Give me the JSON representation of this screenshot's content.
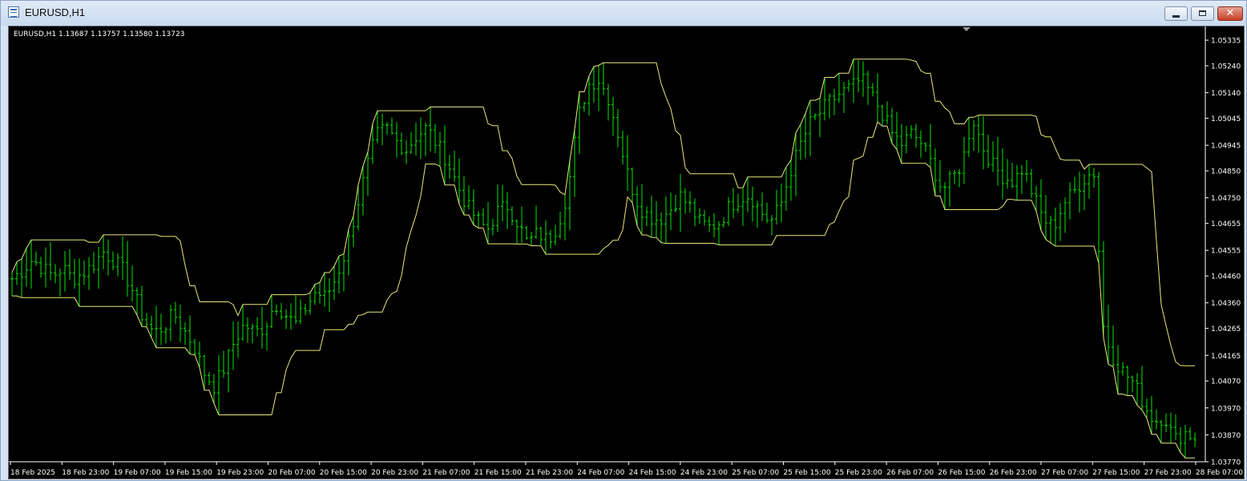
{
  "window": {
    "title": "EURUSD,H1",
    "icon": "chart-window-icon",
    "buttons": [
      "minimize-icon",
      "maximize-icon",
      "close-icon"
    ],
    "close_glyph": "✕"
  },
  "chart_info": "EURUSD,H1  1.13687 1.13757 1.13580 1.13723",
  "colors": {
    "background": "#000000",
    "candles": "#00e600",
    "channel": "#e8e87a",
    "axis": "#ffffff",
    "text": "#ffffff"
  },
  "chart_data": {
    "type": "ohlc",
    "symbol": "EURUSD",
    "timeframe": "H1",
    "title": "EURUSD,H1",
    "info": "1.13687 1.13757 1.13580 1.13723",
    "ylim": [
      1.0377,
      1.0538
    ],
    "y_ticks": [
      "1.05335",
      "1.05240",
      "1.05140",
      "1.05045",
      "1.04945",
      "1.04850",
      "1.04750",
      "1.04655",
      "1.04555",
      "1.04460",
      "1.04360",
      "1.04265",
      "1.04165",
      "1.04070",
      "1.03970",
      "1.03870",
      "1.03770"
    ],
    "x_ticks": [
      "18 Feb 2025",
      "18 Feb 23:00",
      "19 Feb 07:00",
      "19 Feb 15:00",
      "19 Feb 23:00",
      "20 Feb 07:00",
      "20 Feb 15:00",
      "20 Feb 23:00",
      "21 Feb 07:00",
      "21 Feb 15:00",
      "21 Feb 23:00",
      "24 Feb 07:00",
      "24 Feb 15:00",
      "24 Feb 23:00",
      "25 Feb 07:00",
      "25 Feb 15:00",
      "25 Feb 23:00",
      "26 Feb 07:00",
      "26 Feb 15:00",
      "26 Feb 23:00",
      "27 Feb 07:00",
      "27 Feb 15:00",
      "27 Feb 23:00",
      "28 Feb 07:00"
    ],
    "close_path": [
      1.0445,
      1.0448,
      1.0452,
      1.0449,
      1.0446,
      1.0449,
      1.0445,
      1.0447,
      1.045,
      1.0455,
      1.0452,
      1.0448,
      1.044,
      1.043,
      1.0425,
      1.0427,
      1.0432,
      1.0426,
      1.042,
      1.041,
      1.0405,
      1.0412,
      1.0422,
      1.0428,
      1.0425,
      1.0427,
      1.0436,
      1.0432,
      1.0428,
      1.0434,
      1.044,
      1.0438,
      1.0445,
      1.0455,
      1.047,
      1.0485,
      1.0498,
      1.0501,
      1.0496,
      1.0493,
      1.0498,
      1.0501,
      1.0495,
      1.0489,
      1.048,
      1.0472,
      1.0467,
      1.0463,
      1.047,
      1.0472,
      1.0466,
      1.0458,
      1.0462,
      1.0459,
      1.0465,
      1.0478,
      1.0505,
      1.0517,
      1.0519,
      1.0512,
      1.0498,
      1.0482,
      1.0472,
      1.0468,
      1.0467,
      1.047,
      1.0476,
      1.0472,
      1.0466,
      1.0464,
      1.0466,
      1.0472,
      1.0475,
      1.0476,
      1.047,
      1.0466,
      1.0472,
      1.0485,
      1.0495,
      1.0503,
      1.0507,
      1.0511,
      1.0514,
      1.0516,
      1.0519,
      1.0513,
      1.0507,
      1.0499,
      1.0495,
      1.0499,
      1.0495,
      1.0487,
      1.0478,
      1.0482,
      1.0488,
      1.0505,
      1.0494,
      1.0487,
      1.0483,
      1.0481,
      1.0486,
      1.0476,
      1.0467,
      1.0464,
      1.0473,
      1.0477,
      1.0482,
      1.0485,
      1.0425,
      1.0415,
      1.041,
      1.0406,
      1.0398,
      1.0392,
      1.0394,
      1.0385,
      1.0388,
      1.0386
    ]
  }
}
